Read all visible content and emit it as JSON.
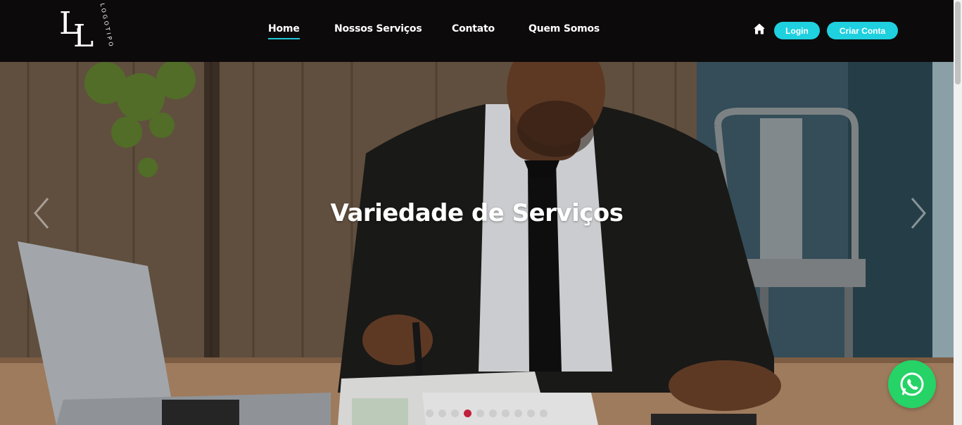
{
  "brand": {
    "logo_letters_1": "L",
    "logo_letters_2": "L",
    "logo_word": "LOGOTIPO"
  },
  "nav": {
    "items": [
      {
        "label": "Home",
        "active": true
      },
      {
        "label": "Nossos Serviços",
        "active": false
      },
      {
        "label": "Contato",
        "active": false
      },
      {
        "label": "Quem Somos",
        "active": false
      }
    ],
    "home_icon": "home-icon",
    "login_label": "Login",
    "signup_label": "Criar Conta"
  },
  "hero": {
    "title": "Variedade de Serviços",
    "slide_count": 10,
    "active_slide": 4,
    "prev_icon": "chevron-left-icon",
    "next_icon": "chevron-right-icon"
  },
  "whatsapp": {
    "icon": "whatsapp-icon"
  },
  "colors": {
    "nav_bg": "#0d0a0b",
    "accent": "#1fd0df",
    "active_dot": "#c0203c",
    "whatsapp": "#25d366"
  }
}
